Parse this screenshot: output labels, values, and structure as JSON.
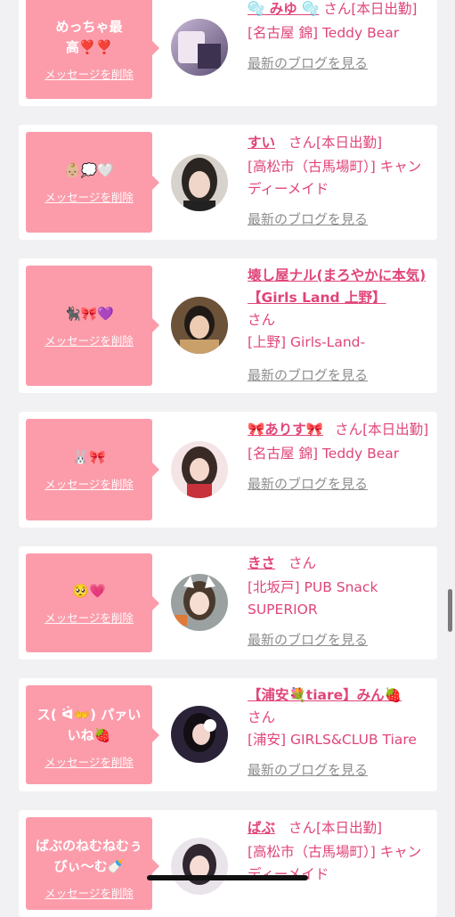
{
  "items": [
    {
      "message": "めっちゃ最高❣️❣️",
      "delete_label": "メッセージを削除",
      "name": "🫧 みゆ 🫧",
      "san": "さん",
      "badge": "[本日出勤]",
      "shop": "[名古屋 錦] Teddy Bear",
      "blog_label": "最新のブログを見る",
      "avatar_icon": "avatar-photo"
    },
    {
      "message": "👶🏼💭🤍",
      "delete_label": "メッセージを削除",
      "name": "すい",
      "san": "さん",
      "badge": "[本日出勤]",
      "shop": "[高松市（古馬場町）] キャンディーメイド",
      "blog_label": "最新のブログを見る",
      "avatar_icon": "avatar-photo"
    },
    {
      "message": "🐈‍⬛🎀💜",
      "delete_label": "メッセージを削除",
      "name": "壊し屋ナル(まろやかに本気)【Girls Land 上野】",
      "san": "さん",
      "badge": "",
      "shop": "[上野] Girls-Land-",
      "blog_label": "最新のブログを見る",
      "avatar_icon": "avatar-photo"
    },
    {
      "message": "🐰🎀",
      "delete_label": "メッセージを削除",
      "name": "🎀ありす🎀",
      "san": "さん",
      "badge": "[本日出勤]",
      "shop": "[名古屋 錦] Teddy Bear",
      "blog_label": "最新のブログを見る",
      "avatar_icon": "avatar-photo"
    },
    {
      "message": "🥺💗",
      "delete_label": "メッセージを削除",
      "name": "きさ",
      "san": "さん",
      "badge": "",
      "shop": "[北坂戸] PUB Snack SUPERIOR",
      "blog_label": "最新のブログを見る",
      "avatar_icon": "avatar-photo"
    },
    {
      "message": "ス( ᐛ👐) パァいいね🍓",
      "delete_label": "メッセージを削除",
      "name": "【浦安💐tiare】みん🍓",
      "san": "さん",
      "badge": "",
      "shop": "[浦安] GIRLS&CLUB Tiare",
      "blog_label": "最新のブログを見る",
      "avatar_icon": "avatar-photo"
    },
    {
      "message": "ばぶのねむねむぅびぃ〜む🍼",
      "delete_label": "メッセージを削除",
      "name": "ばぶ",
      "san": "さん",
      "badge": "[本日出勤]",
      "shop": "[高松市（古馬場町）] キャンディーメイド",
      "blog_label": "最新のブログを見る",
      "avatar_icon": "avatar-photo"
    }
  ],
  "colors": {
    "accent": "#e0457a",
    "message_bg": "#fc9cab",
    "page_bg": "#f1f1f3"
  }
}
